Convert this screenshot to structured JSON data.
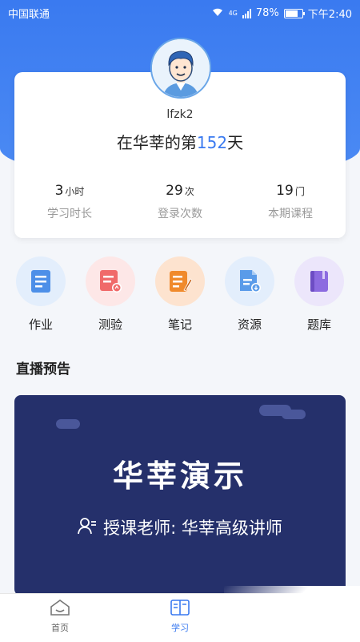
{
  "status_bar": {
    "carrier": "中国联通",
    "network_label": "4G",
    "battery": "78%",
    "battery_level": 0.78,
    "time": "下午2:40"
  },
  "profile": {
    "username": "lfzk2",
    "day_prefix": "在华莘的第",
    "day_number": "152",
    "day_suffix": "天"
  },
  "stats": [
    {
      "value": "3",
      "unit": "小时",
      "label": "学习时长"
    },
    {
      "value": "29",
      "unit": "次",
      "label": "登录次数"
    },
    {
      "value": "19",
      "unit": "门",
      "label": "本期课程"
    }
  ],
  "shortcuts": [
    {
      "label": "作业",
      "icon": "homework-icon"
    },
    {
      "label": "测验",
      "icon": "quiz-icon"
    },
    {
      "label": "笔记",
      "icon": "notes-icon"
    },
    {
      "label": "资源",
      "icon": "resources-icon"
    },
    {
      "label": "题库",
      "icon": "question-bank-icon"
    }
  ],
  "live_section": {
    "title": "直播预告",
    "card_title": "华莘演示",
    "teacher": "授课老师: 华莘高级讲师"
  },
  "tabbar": {
    "home": "首页",
    "study": "学习"
  },
  "colors": {
    "brand_blue": "#3a7af0",
    "live_card_bg": "#25306b"
  }
}
